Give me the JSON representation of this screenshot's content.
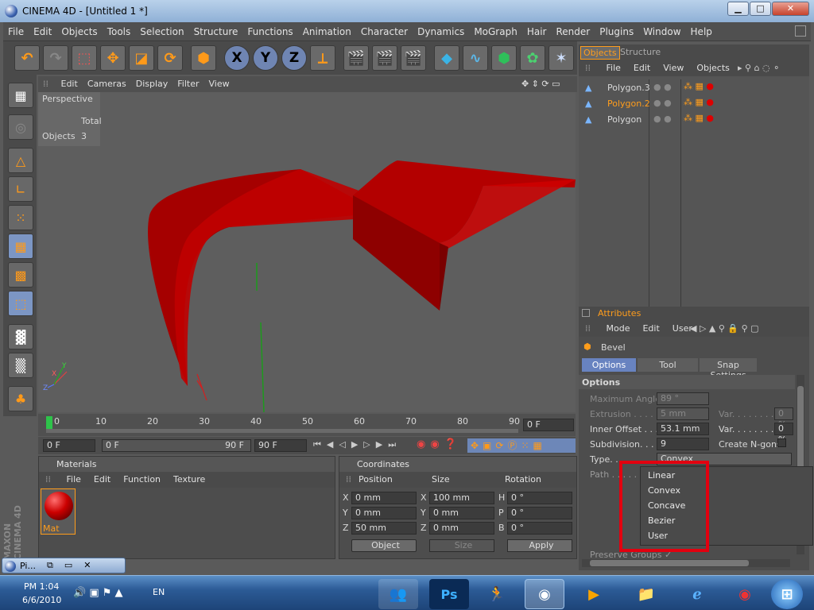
{
  "window": {
    "title": "CINEMA 4D - [Untitled 1 *]",
    "min": "▁",
    "max": "□",
    "close": "✕"
  },
  "menubar": [
    "File",
    "Edit",
    "Objects",
    "Tools",
    "Selection",
    "Structure",
    "Functions",
    "Animation",
    "Character",
    "Dynamics",
    "MoGraph",
    "Hair",
    "Render",
    "Plugins",
    "Window",
    "Help"
  ],
  "toolbar": {
    "x": "X",
    "y": "Y",
    "z": "Z"
  },
  "viewport": {
    "menu": [
      "Edit",
      "Cameras",
      "Display",
      "Filter",
      "View"
    ],
    "camera": "Perspective",
    "stats_header": "Total",
    "stats_label": "Objects",
    "stats_value": "3",
    "axes": {
      "x": "X",
      "y": "Y",
      "z": "Z"
    }
  },
  "timeline": {
    "ticks": [
      "0",
      "10",
      "20",
      "30",
      "40",
      "50",
      "60",
      "70",
      "80",
      "90"
    ],
    "current": "0 F"
  },
  "playbar": {
    "start": "0 F",
    "range_left": "0 F",
    "range_right": "90 F",
    "end": "90 F"
  },
  "materials": {
    "title": "Materials",
    "menu": [
      "File",
      "Edit",
      "Function",
      "Texture"
    ],
    "mat_name": "Mat"
  },
  "coordinates": {
    "title": "Coordinates",
    "headers": [
      "Position",
      "Size",
      "Rotation"
    ],
    "rows": [
      {
        "a": "X",
        "pos": "0 mm",
        "b": "X",
        "size": "100 mm",
        "c": "H",
        "rot": "0 °"
      },
      {
        "a": "Y",
        "pos": "0 mm",
        "b": "Y",
        "size": "0 mm",
        "c": "P",
        "rot": "0 °"
      },
      {
        "a": "Z",
        "pos": "50 mm",
        "b": "Z",
        "size": "0 mm",
        "c": "B",
        "rot": "0 °"
      }
    ],
    "mode": "Object",
    "size_mode": "Size",
    "apply": "Apply"
  },
  "objects": {
    "tabs": [
      "Objects",
      "Structure"
    ],
    "menu": [
      "File",
      "Edit",
      "View",
      "Objects"
    ],
    "items": [
      {
        "name": "Polygon.3",
        "color": "#e0e0e0"
      },
      {
        "name": "Polygon.2",
        "color": "#ff9d1c"
      },
      {
        "name": "Polygon",
        "color": "#e0e0e0"
      }
    ]
  },
  "attributes": {
    "title": "Attributes",
    "menu": [
      "Mode",
      "Edit",
      "User"
    ],
    "tool": "Bevel",
    "tabs": [
      "Options",
      "Tool",
      "Snap Settings"
    ],
    "section": "Options",
    "fields": {
      "max_angle_label": "Maximum Angle",
      "max_angle": "89 °",
      "extrusion_label": "Extrusion . . . . .",
      "extrusion": "5 mm",
      "var1_label": "Var. . . . . . . . .",
      "var1": "0 %",
      "inner_label": "Inner Offset . . .",
      "inner": "53.1 mm",
      "var2_label": "Var. . . . . . . . .",
      "var2": "0 %",
      "subdiv_label": "Subdivision. . . .",
      "subdiv": "9",
      "ngons_label": "Create N-gons",
      "type_label": "Type. . . . . . . .",
      "type": "Convex",
      "path_label": "Path . . . . . . . .",
      "preserve_label": "Preserve Groups ✓"
    },
    "dropdown": [
      "Linear",
      "Convex",
      "Concave",
      "Bezier",
      "User"
    ]
  },
  "taskbar": {
    "task_label": "Pi...",
    "time": "PM 1:04",
    "date": "6/6/2010",
    "lang": "EN",
    "ps": "Ps"
  },
  "brand": "MAXON CINEMA 4D",
  "colors": {
    "accent": "#ff9d1c",
    "highlight": "#e2000f",
    "selected_tab": "#6883c0"
  }
}
